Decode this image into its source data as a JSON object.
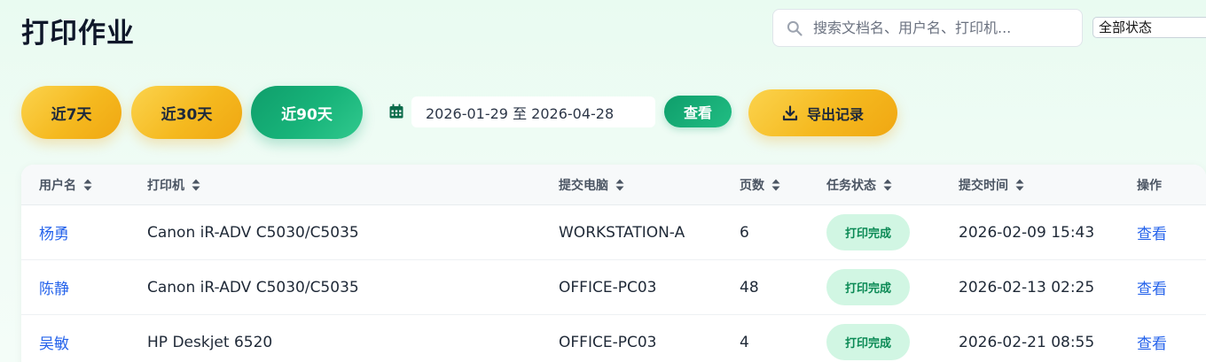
{
  "header": {
    "title": "打印作业",
    "search_placeholder": "搜索文档名、用户名、打印机...",
    "status_filter": "全部状态"
  },
  "toolbar": {
    "ranges": [
      {
        "label": "近7天",
        "active": false
      },
      {
        "label": "近30天",
        "active": false
      },
      {
        "label": "近90天",
        "active": true
      }
    ],
    "date_range": "2026-01-29 至 2026-04-28",
    "query_label": "查看",
    "export_label": "导出记录"
  },
  "table": {
    "columns": [
      "用户名",
      "打印机",
      "提交电脑",
      "页数",
      "任务状态",
      "提交时间",
      "操作"
    ],
    "rows": [
      {
        "user": "杨勇",
        "printer": "Canon iR-ADV C5030/C5035",
        "computer": "WORKSTATION-A",
        "pages": "6",
        "status": "打印完成",
        "time": "2026-02-09 15:43",
        "action": "查看"
      },
      {
        "user": "陈静",
        "printer": "Canon iR-ADV C5030/C5035",
        "computer": "OFFICE-PC03",
        "pages": "48",
        "status": "打印完成",
        "time": "2026-02-13 02:25",
        "action": "查看"
      },
      {
        "user": "吴敏",
        "printer": "HP Deskjet 6520",
        "computer": "OFFICE-PC03",
        "pages": "4",
        "status": "打印完成",
        "time": "2026-02-21 08:55",
        "action": "查看"
      }
    ]
  },
  "colors": {
    "accent_green": "#0f9e6b",
    "accent_yellow": "#f5b91f",
    "link_blue": "#2563eb",
    "badge_bg": "#d1f6e3",
    "badge_text": "#0b8a55"
  }
}
